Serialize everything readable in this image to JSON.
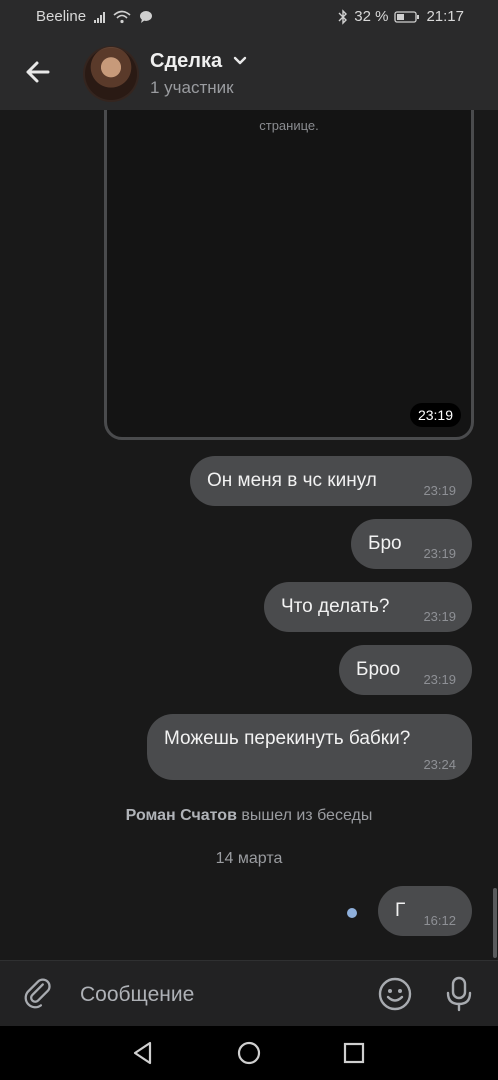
{
  "status_bar": {
    "carrier": "Beeline",
    "battery": "32 %",
    "time": "21:17"
  },
  "header": {
    "title": "Сделка",
    "subtitle": "1 участник"
  },
  "media": {
    "caption": "странице.",
    "time": "23:19"
  },
  "messages": [
    {
      "text": "Он меня в чс кинул",
      "time": "23:19"
    },
    {
      "text": "Бро",
      "time": "23:19"
    },
    {
      "text": "Что делать?",
      "time": "23:19"
    },
    {
      "text": "Броо",
      "time": "23:19"
    },
    {
      "text": "Можешь перекинуть бабки?",
      "time": "23:24"
    }
  ],
  "system_message": {
    "name": "Роман Счатов",
    "action": "вышел из беседы"
  },
  "date_separator": "14 марта",
  "last_message": {
    "text": "Г",
    "time": "16:12"
  },
  "composer": {
    "placeholder": "Сообщение"
  },
  "colors": {
    "bubble": "#4a4b4d",
    "background": "#191919",
    "unread_dot": "#8fb0dc"
  }
}
